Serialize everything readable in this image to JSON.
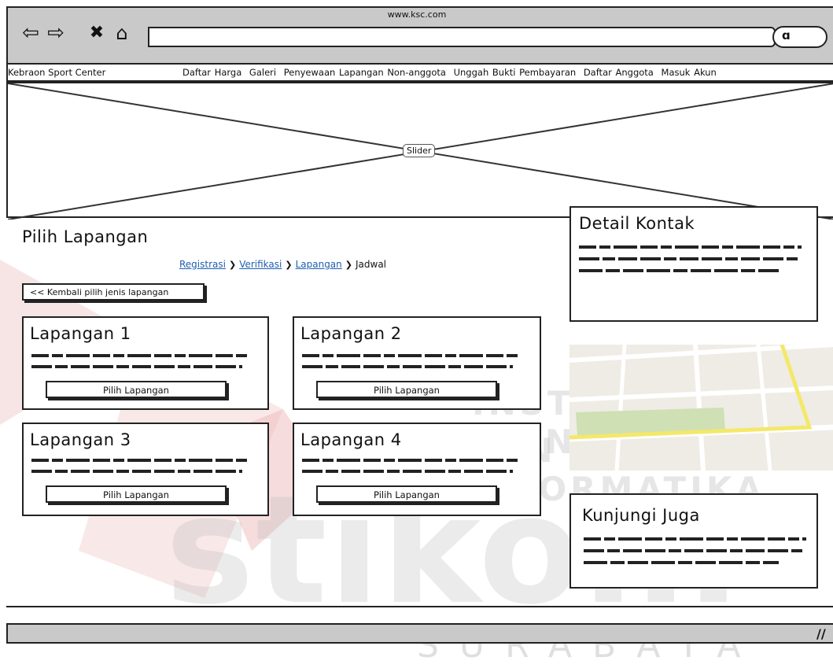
{
  "browser": {
    "url": "www.ksc.com",
    "icons": [
      "back-arrow-icon",
      "forward-arrow-icon",
      "close-icon",
      "home-icon"
    ],
    "search_icon": "search-icon"
  },
  "nav": {
    "site_name": "Kebraon Sport Center",
    "links": [
      "Daftar Harga",
      "Galeri",
      "Penyewaan Lapangan Non-anggota",
      "Unggah Bukti Pembayaran",
      "Daftar Anggota",
      "Masuk Akun"
    ]
  },
  "slider": {
    "label": "Slider"
  },
  "main": {
    "title": "Pilih Lapangan",
    "breadcrumb": {
      "steps": [
        "Registrasi",
        "Verifikasi",
        "Lapangan"
      ],
      "current": "Jadwal"
    },
    "back_button": "<< Kembali pilih jenis lapangan",
    "cards": [
      {
        "title": "Lapangan 1",
        "button": "Pilih Lapangan"
      },
      {
        "title": "Lapangan 2",
        "button": "Pilih Lapangan"
      },
      {
        "title": "Lapangan 3",
        "button": "Pilih Lapangan"
      },
      {
        "title": "Lapangan 4",
        "button": "Pilih Lapangan"
      }
    ]
  },
  "sidebar": {
    "detail_title": "Detail Kontak",
    "visit_title": "Kunjungi Juga"
  },
  "watermark": {
    "line1": "INSTITUT BISNIS",
    "line2": "DAN INFORMATIKA",
    "brand": "stikom",
    "city": "SURABAYA"
  },
  "colors": {
    "chrome": "#c9c9c9",
    "link": "#2060b0",
    "logo_red": "#d9534f"
  }
}
